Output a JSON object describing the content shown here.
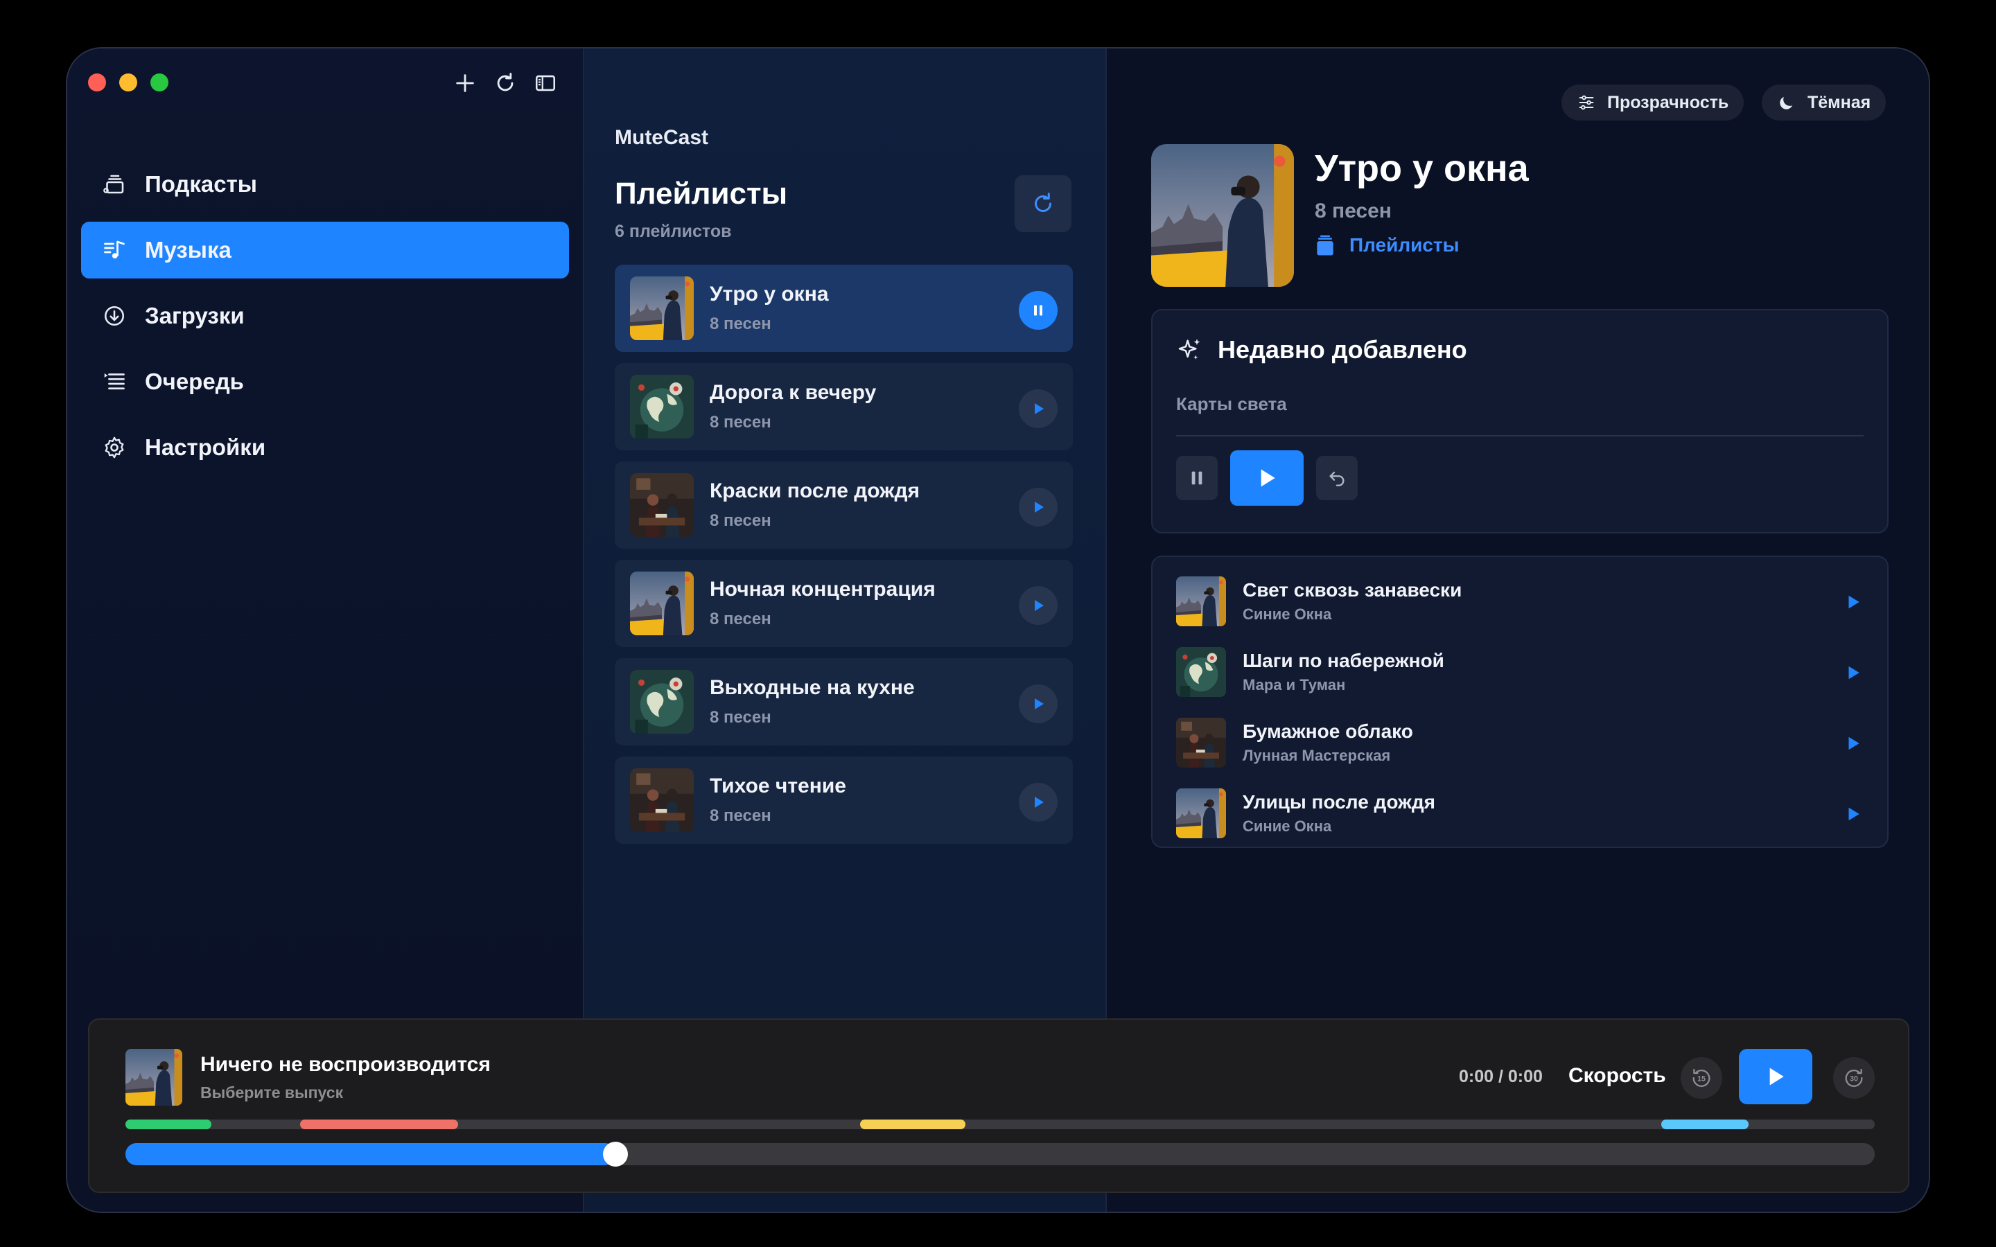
{
  "sidebar": {
    "toolbar": [
      {
        "icon": "plus-icon"
      },
      {
        "icon": "refresh-icon"
      },
      {
        "icon": "sidebar-toggle-icon"
      }
    ],
    "items": [
      {
        "label": "Подкасты",
        "icon": "podcasts-icon",
        "active": false
      },
      {
        "label": "Музыка",
        "icon": "music-icon",
        "active": true
      },
      {
        "label": "Загрузки",
        "icon": "download-icon",
        "active": false
      },
      {
        "label": "Очередь",
        "icon": "queue-icon",
        "active": false
      },
      {
        "label": "Настройки",
        "icon": "settings-icon",
        "active": false
      }
    ]
  },
  "middle": {
    "brand": "MuteCast",
    "title": "Плейлисты",
    "count": "6 плейлистов",
    "playlists": [
      {
        "name": "Утро у окна",
        "sub": "8 песен",
        "cover": "window",
        "active": true
      },
      {
        "name": "Дорога к вечеру",
        "sub": "8 песен",
        "cover": "globe",
        "active": false
      },
      {
        "name": "Краски после дождя",
        "sub": "8 песен",
        "cover": "room",
        "active": false
      },
      {
        "name": "Ночная концентрация",
        "sub": "8 песен",
        "cover": "window",
        "active": false
      },
      {
        "name": "Выходные на кухне",
        "sub": "8 песен",
        "cover": "globe",
        "active": false
      },
      {
        "name": "Тихое чтение",
        "sub": "8 песен",
        "cover": "room",
        "active": false
      }
    ]
  },
  "right": {
    "chips": {
      "transparency": "Прозрачность",
      "theme": "Тёмная"
    },
    "hero": {
      "title": "Утро у окна",
      "sub": "8 песен",
      "link": "Плейлисты"
    },
    "recent": {
      "title": "Недавно добавлено",
      "subtitle": "Карты света"
    },
    "tracks": [
      {
        "name": "Свет сквозь занавески",
        "artist": "Синие Окна",
        "cover": "window"
      },
      {
        "name": "Шаги по набережной",
        "artist": "Мара и Туман",
        "cover": "globe"
      },
      {
        "name": "Бумажное облако",
        "artist": "Лунная Мастерская",
        "cover": "room"
      },
      {
        "name": "Улицы после дождя",
        "artist": "Синие Окна",
        "cover": "window"
      }
    ]
  },
  "player": {
    "title": "Ничего не воспроизводится",
    "subtitle": "Выберите выпуск",
    "time": "0:00 / 0:00",
    "speed": "Скорость",
    "skip_back": "15",
    "skip_forward": "30",
    "segments": [
      {
        "start": 0.0,
        "end": 0.049,
        "color": "#2ecc71"
      },
      {
        "start": 0.1,
        "end": 0.19,
        "color": "#f07167"
      },
      {
        "start": 0.42,
        "end": 0.48,
        "color": "#f7d154"
      },
      {
        "start": 0.878,
        "end": 0.928,
        "color": "#5ac8fa"
      }
    ],
    "progress": 0.28
  },
  "colors": {
    "accent": "#1e84ff",
    "link": "#3d8dff"
  }
}
